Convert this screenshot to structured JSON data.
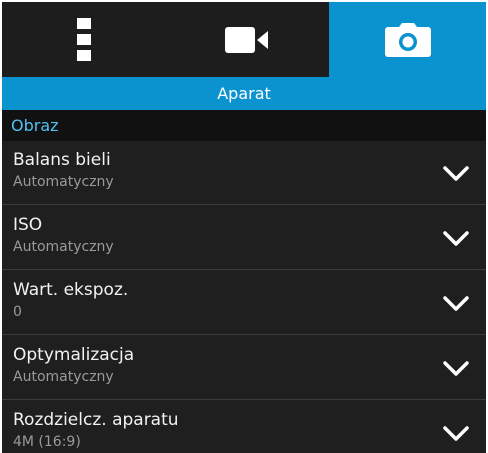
{
  "tabs": [
    {
      "icon": "vertical-dots-icon"
    },
    {
      "icon": "video-camera-icon"
    },
    {
      "icon": "camera-icon",
      "active": true
    }
  ],
  "header": {
    "title": "Aparat"
  },
  "section": {
    "title": "Obraz"
  },
  "settings": [
    {
      "label": "Balans bieli",
      "value": "Automatyczny"
    },
    {
      "label": "ISO",
      "value": "Automatyczny"
    },
    {
      "label": "Wart. ekspoz.",
      "value": "0"
    },
    {
      "label": "Optymalizacja",
      "value": "Automatyczny"
    },
    {
      "label": "Rozdzielcz. aparatu",
      "value": "4M (16:9)"
    }
  ],
  "colors": {
    "accent": "#0a93cf",
    "section_text": "#50c1f0",
    "background": "#1f1f1f"
  }
}
